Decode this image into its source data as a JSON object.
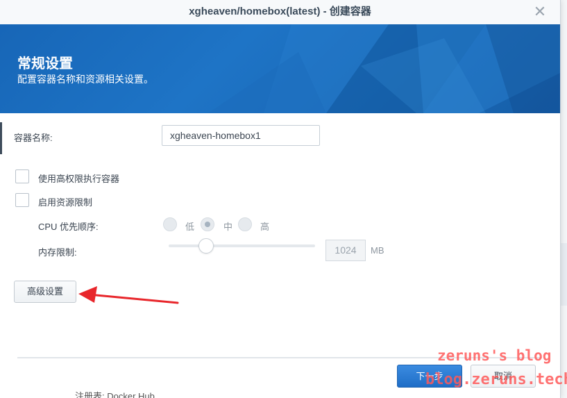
{
  "dialog": {
    "title": "xgheaven/homebox(latest) - 创建容器",
    "close_icon": "close-icon"
  },
  "banner": {
    "heading": "常规设置",
    "subtitle": "配置容器名称和资源相关设置。"
  },
  "form": {
    "container_name_label": "容器名称:",
    "container_name_value": "xgheaven-homebox1",
    "privileged_label": "使用高权限执行容器",
    "privileged_checked": false,
    "resource_limit_label": "启用资源限制",
    "resource_limit_checked": false,
    "cpu_priority_label": "CPU 优先顺序:",
    "cpu_options": [
      {
        "label": "低",
        "selected": false
      },
      {
        "label": "中",
        "selected": true
      },
      {
        "label": "高",
        "selected": false
      }
    ],
    "memory_limit_label": "内存限制:",
    "memory_value": "1024",
    "memory_unit": "MB"
  },
  "buttons": {
    "advanced": "高级设置",
    "next": "下一步",
    "cancel": "取消"
  },
  "background": {
    "behind_text": "注册表: Docker Hub"
  },
  "watermark": {
    "line1": "zeruns's blog",
    "line2": "blog.zeruns.tech"
  },
  "colors": {
    "accent": "#1f6ec7",
    "banner": "#1766b7",
    "annotation_arrow": "#e8262b",
    "watermark": "#ff5a5a"
  }
}
